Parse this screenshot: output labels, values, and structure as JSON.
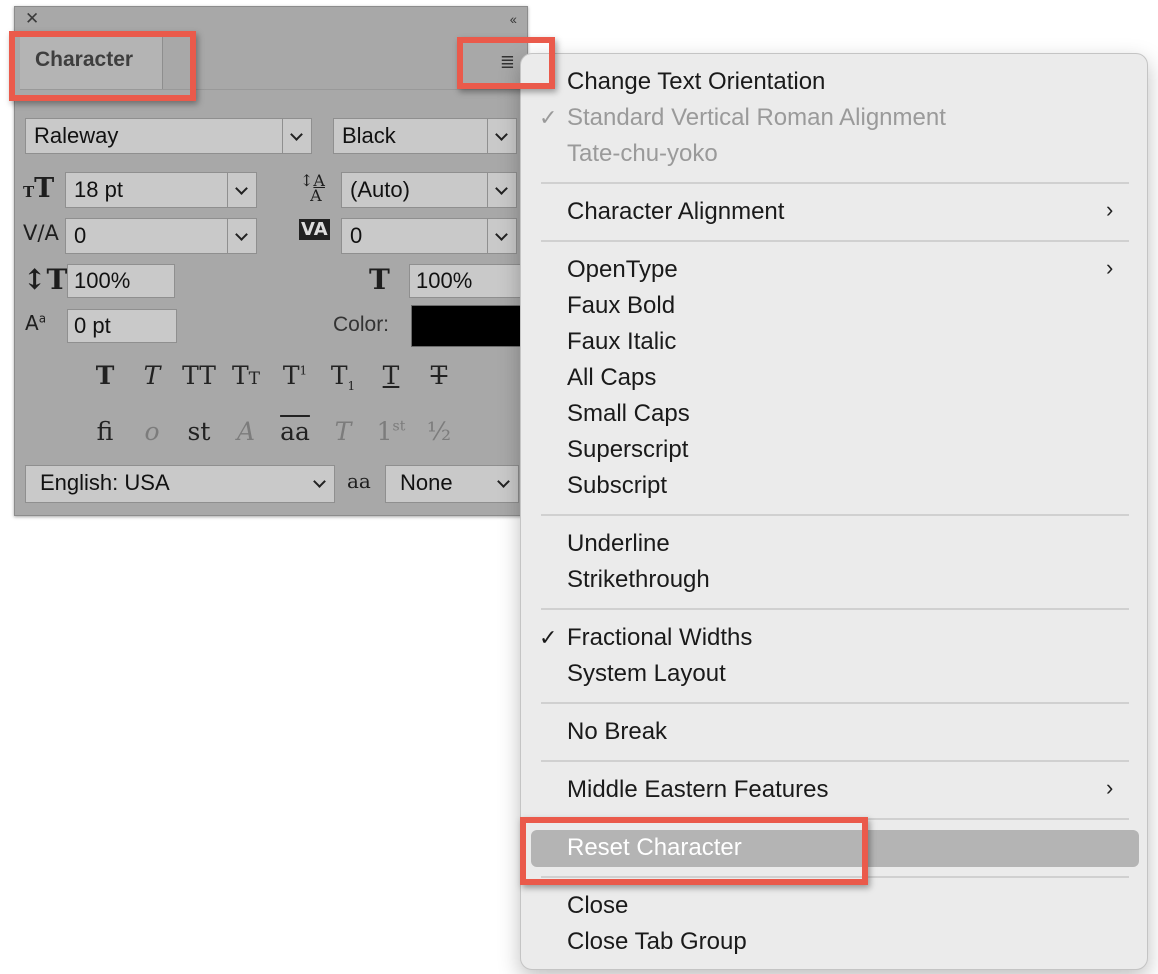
{
  "panel": {
    "tab_label": "Character",
    "font_family": "Raleway",
    "font_style": "Black",
    "font_size": "18 pt",
    "leading": "(Auto)",
    "kerning": "0",
    "tracking": "0",
    "vertical_scale": "100%",
    "horizontal_scale": "100%",
    "baseline_shift": "0 pt",
    "color_label": "Color:",
    "color_value": "#000000",
    "language": "English: USA",
    "antialias": "None",
    "antialias_icon_text": "aa"
  },
  "menu": {
    "items": [
      {
        "label": "Change Text Orientation"
      },
      {
        "label": "Standard Vertical Roman Alignment"
      },
      {
        "label": "Tate-chu-yoko"
      },
      {
        "label": "Character Alignment"
      },
      {
        "label": "OpenType"
      },
      {
        "label": "Faux Bold"
      },
      {
        "label": "Faux Italic"
      },
      {
        "label": "All Caps"
      },
      {
        "label": "Small Caps"
      },
      {
        "label": "Superscript"
      },
      {
        "label": "Subscript"
      },
      {
        "label": "Underline"
      },
      {
        "label": "Strikethrough"
      },
      {
        "label": "Fractional Widths"
      },
      {
        "label": "System Layout"
      },
      {
        "label": "No Break"
      },
      {
        "label": "Middle Eastern Features"
      },
      {
        "label": "Reset Character"
      },
      {
        "label": "Close"
      },
      {
        "label": "Close Tab Group"
      }
    ]
  },
  "colors": {
    "callout": "#ea5a4b",
    "panel_bg": "#a8a8a8",
    "menu_bg": "#ebebeb",
    "highlight": "#b4b4b4"
  }
}
